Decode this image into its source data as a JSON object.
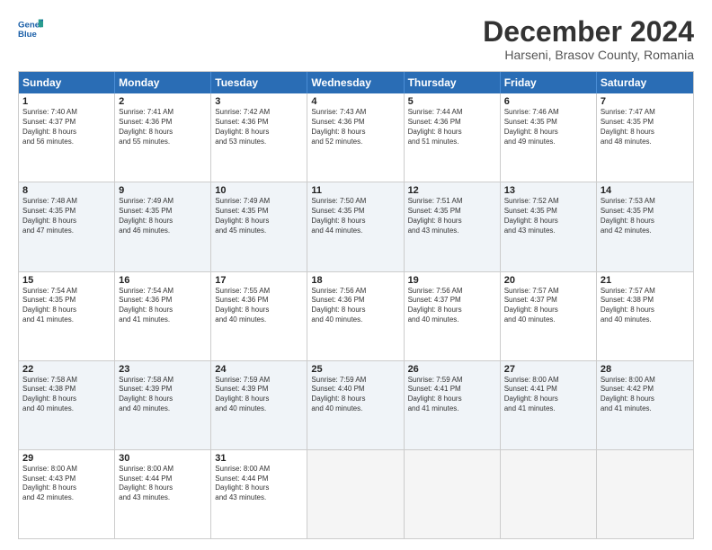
{
  "header": {
    "logo_line1": "General",
    "logo_line2": "Blue",
    "title": "December 2024",
    "subtitle": "Harseni, Brasov County, Romania"
  },
  "weekdays": [
    "Sunday",
    "Monday",
    "Tuesday",
    "Wednesday",
    "Thursday",
    "Friday",
    "Saturday"
  ],
  "rows": [
    [
      {
        "day": "1",
        "lines": [
          "Sunrise: 7:40 AM",
          "Sunset: 4:37 PM",
          "Daylight: 8 hours",
          "and 56 minutes."
        ]
      },
      {
        "day": "2",
        "lines": [
          "Sunrise: 7:41 AM",
          "Sunset: 4:36 PM",
          "Daylight: 8 hours",
          "and 55 minutes."
        ]
      },
      {
        "day": "3",
        "lines": [
          "Sunrise: 7:42 AM",
          "Sunset: 4:36 PM",
          "Daylight: 8 hours",
          "and 53 minutes."
        ]
      },
      {
        "day": "4",
        "lines": [
          "Sunrise: 7:43 AM",
          "Sunset: 4:36 PM",
          "Daylight: 8 hours",
          "and 52 minutes."
        ]
      },
      {
        "day": "5",
        "lines": [
          "Sunrise: 7:44 AM",
          "Sunset: 4:36 PM",
          "Daylight: 8 hours",
          "and 51 minutes."
        ]
      },
      {
        "day": "6",
        "lines": [
          "Sunrise: 7:46 AM",
          "Sunset: 4:35 PM",
          "Daylight: 8 hours",
          "and 49 minutes."
        ]
      },
      {
        "day": "7",
        "lines": [
          "Sunrise: 7:47 AM",
          "Sunset: 4:35 PM",
          "Daylight: 8 hours",
          "and 48 minutes."
        ]
      }
    ],
    [
      {
        "day": "8",
        "lines": [
          "Sunrise: 7:48 AM",
          "Sunset: 4:35 PM",
          "Daylight: 8 hours",
          "and 47 minutes."
        ]
      },
      {
        "day": "9",
        "lines": [
          "Sunrise: 7:49 AM",
          "Sunset: 4:35 PM",
          "Daylight: 8 hours",
          "and 46 minutes."
        ]
      },
      {
        "day": "10",
        "lines": [
          "Sunrise: 7:49 AM",
          "Sunset: 4:35 PM",
          "Daylight: 8 hours",
          "and 45 minutes."
        ]
      },
      {
        "day": "11",
        "lines": [
          "Sunrise: 7:50 AM",
          "Sunset: 4:35 PM",
          "Daylight: 8 hours",
          "and 44 minutes."
        ]
      },
      {
        "day": "12",
        "lines": [
          "Sunrise: 7:51 AM",
          "Sunset: 4:35 PM",
          "Daylight: 8 hours",
          "and 43 minutes."
        ]
      },
      {
        "day": "13",
        "lines": [
          "Sunrise: 7:52 AM",
          "Sunset: 4:35 PM",
          "Daylight: 8 hours",
          "and 43 minutes."
        ]
      },
      {
        "day": "14",
        "lines": [
          "Sunrise: 7:53 AM",
          "Sunset: 4:35 PM",
          "Daylight: 8 hours",
          "and 42 minutes."
        ]
      }
    ],
    [
      {
        "day": "15",
        "lines": [
          "Sunrise: 7:54 AM",
          "Sunset: 4:35 PM",
          "Daylight: 8 hours",
          "and 41 minutes."
        ]
      },
      {
        "day": "16",
        "lines": [
          "Sunrise: 7:54 AM",
          "Sunset: 4:36 PM",
          "Daylight: 8 hours",
          "and 41 minutes."
        ]
      },
      {
        "day": "17",
        "lines": [
          "Sunrise: 7:55 AM",
          "Sunset: 4:36 PM",
          "Daylight: 8 hours",
          "and 40 minutes."
        ]
      },
      {
        "day": "18",
        "lines": [
          "Sunrise: 7:56 AM",
          "Sunset: 4:36 PM",
          "Daylight: 8 hours",
          "and 40 minutes."
        ]
      },
      {
        "day": "19",
        "lines": [
          "Sunrise: 7:56 AM",
          "Sunset: 4:37 PM",
          "Daylight: 8 hours",
          "and 40 minutes."
        ]
      },
      {
        "day": "20",
        "lines": [
          "Sunrise: 7:57 AM",
          "Sunset: 4:37 PM",
          "Daylight: 8 hours",
          "and 40 minutes."
        ]
      },
      {
        "day": "21",
        "lines": [
          "Sunrise: 7:57 AM",
          "Sunset: 4:38 PM",
          "Daylight: 8 hours",
          "and 40 minutes."
        ]
      }
    ],
    [
      {
        "day": "22",
        "lines": [
          "Sunrise: 7:58 AM",
          "Sunset: 4:38 PM",
          "Daylight: 8 hours",
          "and 40 minutes."
        ]
      },
      {
        "day": "23",
        "lines": [
          "Sunrise: 7:58 AM",
          "Sunset: 4:39 PM",
          "Daylight: 8 hours",
          "and 40 minutes."
        ]
      },
      {
        "day": "24",
        "lines": [
          "Sunrise: 7:59 AM",
          "Sunset: 4:39 PM",
          "Daylight: 8 hours",
          "and 40 minutes."
        ]
      },
      {
        "day": "25",
        "lines": [
          "Sunrise: 7:59 AM",
          "Sunset: 4:40 PM",
          "Daylight: 8 hours",
          "and 40 minutes."
        ]
      },
      {
        "day": "26",
        "lines": [
          "Sunrise: 7:59 AM",
          "Sunset: 4:41 PM",
          "Daylight: 8 hours",
          "and 41 minutes."
        ]
      },
      {
        "day": "27",
        "lines": [
          "Sunrise: 8:00 AM",
          "Sunset: 4:41 PM",
          "Daylight: 8 hours",
          "and 41 minutes."
        ]
      },
      {
        "day": "28",
        "lines": [
          "Sunrise: 8:00 AM",
          "Sunset: 4:42 PM",
          "Daylight: 8 hours",
          "and 41 minutes."
        ]
      }
    ],
    [
      {
        "day": "29",
        "lines": [
          "Sunrise: 8:00 AM",
          "Sunset: 4:43 PM",
          "Daylight: 8 hours",
          "and 42 minutes."
        ]
      },
      {
        "day": "30",
        "lines": [
          "Sunrise: 8:00 AM",
          "Sunset: 4:44 PM",
          "Daylight: 8 hours",
          "and 43 minutes."
        ]
      },
      {
        "day": "31",
        "lines": [
          "Sunrise: 8:00 AM",
          "Sunset: 4:44 PM",
          "Daylight: 8 hours",
          "and 43 minutes."
        ]
      },
      {
        "day": "",
        "lines": []
      },
      {
        "day": "",
        "lines": []
      },
      {
        "day": "",
        "lines": []
      },
      {
        "day": "",
        "lines": []
      }
    ]
  ]
}
